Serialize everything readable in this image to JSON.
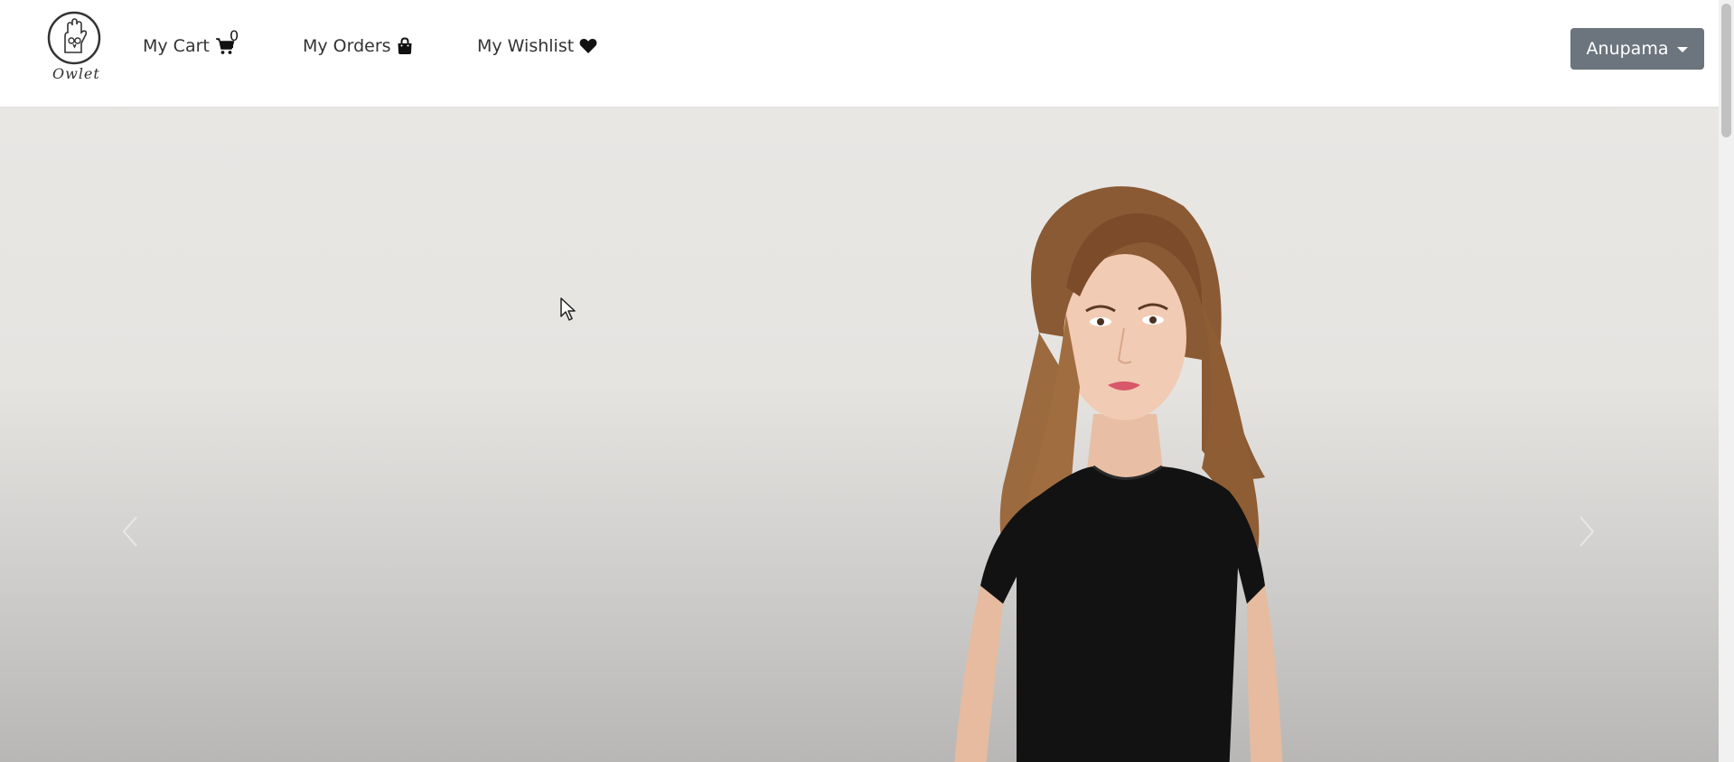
{
  "brand": {
    "logo_text": "Owlet"
  },
  "nav": {
    "cart_label": "My Cart",
    "cart_count": "0",
    "orders_label": "My Orders",
    "wishlist_label": "My Wishlist"
  },
  "user": {
    "name": "Anupama"
  },
  "icons": {
    "cart": "cart-icon",
    "orders": "shopping-bag-icon",
    "wishlist": "heart-icon",
    "prev": "chevron-left-icon",
    "next": "chevron-right-icon",
    "dropdown": "caret-down-icon"
  },
  "colors": {
    "user_button": "#6c757d",
    "hero_background": "#e9e7e4",
    "shirt": "#111111"
  }
}
